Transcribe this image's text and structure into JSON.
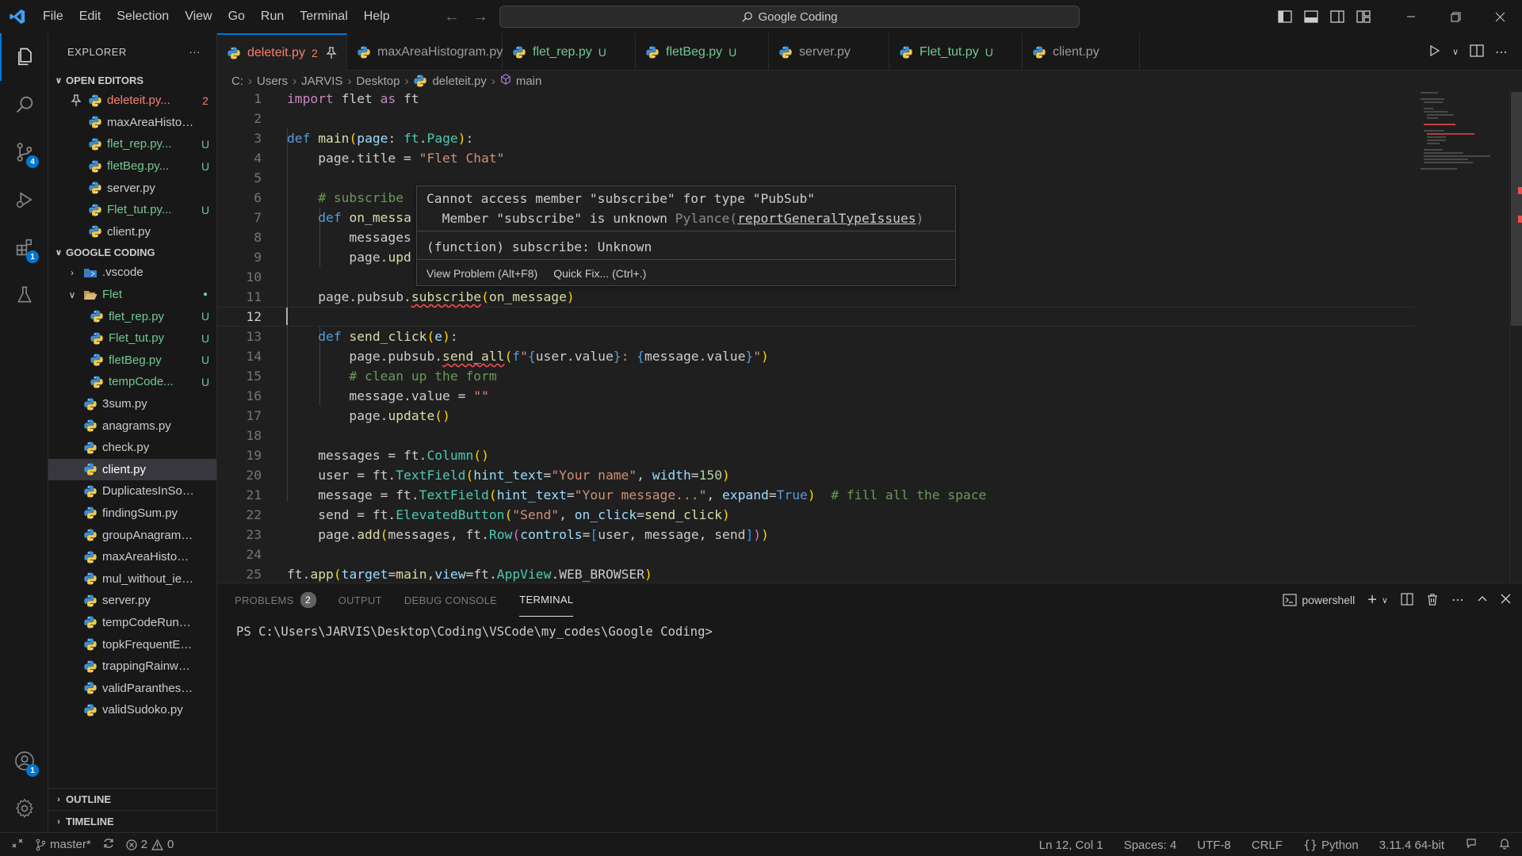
{
  "titlebar": {
    "menu": [
      "File",
      "Edit",
      "Selection",
      "View",
      "Go",
      "Run",
      "Terminal",
      "Help"
    ],
    "search_text": "Google Coding"
  },
  "activity": {
    "source_control_badge": "4",
    "extensions_badge": "1",
    "accounts_badge": "1"
  },
  "sidebar": {
    "title": "EXPLORER",
    "more": "···",
    "open_editors_label": "OPEN EDITORS",
    "open_editors": [
      {
        "name": "deleteit.py...",
        "status": "2",
        "kind": "error",
        "pinned": true
      },
      {
        "name": "maxAreaHistogr...",
        "status": "",
        "kind": "normal"
      },
      {
        "name": "flet_rep.py...",
        "status": "U",
        "kind": "untracked"
      },
      {
        "name": "fletBeg.py...",
        "status": "U",
        "kind": "untracked"
      },
      {
        "name": "server.py",
        "status": "",
        "kind": "normal"
      },
      {
        "name": "Flet_tut.py...",
        "status": "U",
        "kind": "untracked"
      },
      {
        "name": "client.py",
        "status": "",
        "kind": "normal"
      }
    ],
    "folder_label": "GOOGLE CODING",
    "tree": [
      {
        "name": ".vscode",
        "type": "folder-closed",
        "indent": 1,
        "status": "",
        "kind": "normal"
      },
      {
        "name": "Flet",
        "type": "folder-open",
        "indent": 1,
        "status": "●",
        "kind": "untracked"
      },
      {
        "name": "flet_rep.py",
        "type": "file",
        "indent": 2,
        "status": "U",
        "kind": "untracked"
      },
      {
        "name": "Flet_tut.py",
        "type": "file",
        "indent": 2,
        "status": "U",
        "kind": "untracked"
      },
      {
        "name": "fletBeg.py",
        "type": "file",
        "indent": 2,
        "status": "U",
        "kind": "untracked"
      },
      {
        "name": "tempCode...",
        "type": "file",
        "indent": 2,
        "status": "U",
        "kind": "untracked"
      },
      {
        "name": "3sum.py",
        "type": "file",
        "indent": 1,
        "status": "",
        "kind": "normal"
      },
      {
        "name": "anagrams.py",
        "type": "file",
        "indent": 1,
        "status": "",
        "kind": "normal"
      },
      {
        "name": "check.py",
        "type": "file",
        "indent": 1,
        "status": "",
        "kind": "normal"
      },
      {
        "name": "client.py",
        "type": "file",
        "indent": 1,
        "status": "",
        "kind": "selected"
      },
      {
        "name": "DuplicatesInSorte...",
        "type": "file",
        "indent": 1,
        "status": "",
        "kind": "normal"
      },
      {
        "name": "findingSum.py",
        "type": "file",
        "indent": 1,
        "status": "",
        "kind": "normal"
      },
      {
        "name": "groupAnagrams.py",
        "type": "file",
        "indent": 1,
        "status": "",
        "kind": "normal"
      },
      {
        "name": "maxAreaHistogra...",
        "type": "file",
        "indent": 1,
        "status": "",
        "kind": "normal"
      },
      {
        "name": "mul_without_iele...",
        "type": "file",
        "indent": 1,
        "status": "",
        "kind": "normal"
      },
      {
        "name": "server.py",
        "type": "file",
        "indent": 1,
        "status": "",
        "kind": "normal"
      },
      {
        "name": "tempCodeRunner...",
        "type": "file",
        "indent": 1,
        "status": "",
        "kind": "normal"
      },
      {
        "name": "topkFrequentEle...",
        "type": "file",
        "indent": 1,
        "status": "",
        "kind": "normal"
      },
      {
        "name": "trappingRainwate...",
        "type": "file",
        "indent": 1,
        "status": "",
        "kind": "normal"
      },
      {
        "name": "validParanthesis.py",
        "type": "file",
        "indent": 1,
        "status": "",
        "kind": "normal"
      },
      {
        "name": "validSudoko.py",
        "type": "file",
        "indent": 1,
        "status": "",
        "kind": "normal"
      }
    ],
    "outline_label": "OUTLINE",
    "timeline_label": "TIMELINE"
  },
  "tabs": [
    {
      "name": "deleteit.py",
      "badge": "2",
      "active": true,
      "kind": "error"
    },
    {
      "name": "maxAreaHistogram.py",
      "badge": "",
      "active": false,
      "kind": "normal"
    },
    {
      "name": "flet_rep.py",
      "badge": "U",
      "active": false,
      "kind": "untracked"
    },
    {
      "name": "fletBeg.py",
      "badge": "U",
      "active": false,
      "kind": "untracked"
    },
    {
      "name": "server.py",
      "badge": "",
      "active": false,
      "kind": "normal"
    },
    {
      "name": "Flet_tut.py",
      "badge": "U",
      "active": false,
      "kind": "untracked"
    },
    {
      "name": "client.py",
      "badge": "",
      "active": false,
      "kind": "normal"
    }
  ],
  "breadcrumb": [
    "C:",
    "Users",
    "JARVIS",
    "Desktop",
    "deleteit.py",
    "main"
  ],
  "editor": {
    "line_numbers": [
      "1",
      "2",
      "3",
      "4",
      "5",
      "6",
      "7",
      "8",
      "9",
      "10",
      "11",
      "12",
      "13",
      "14",
      "15",
      "16",
      "17",
      "18",
      "19",
      "20",
      "21",
      "22",
      "23",
      "24",
      "25"
    ],
    "current_line": "12"
  },
  "hover": {
    "line1": "Cannot access member \"subscribe\" for type \"PubSub\"",
    "line2_a": "  Member \"subscribe\" is unknown ",
    "line2_source": "Pylance(",
    "line2_rule": "reportGeneralTypeIssues",
    "line2_close": ")",
    "line3": "(function) subscribe: Unknown",
    "action_view": "View Problem (Alt+F8)",
    "action_fix": "Quick Fix... (Ctrl+.)"
  },
  "panel": {
    "tabs": [
      {
        "label": "PROBLEMS",
        "badge": "2",
        "active": false
      },
      {
        "label": "OUTPUT",
        "badge": "",
        "active": false
      },
      {
        "label": "DEBUG CONSOLE",
        "badge": "",
        "active": false
      },
      {
        "label": "TERMINAL",
        "badge": "",
        "active": true
      }
    ],
    "shell": "powershell",
    "terminal_prompt": "PS C:\\Users\\JARVIS\\Desktop\\Coding\\VSCode\\my_codes\\Google Coding>"
  },
  "statusbar": {
    "branch": "master*",
    "errors": "2",
    "warnings": "0",
    "position": "Ln 12, Col 1",
    "spaces": "Spaces: 4",
    "encoding": "UTF-8",
    "eol": "CRLF",
    "language": "Python",
    "interpreter": "3.11.4 64-bit"
  },
  "colors": {
    "accent": "#0078d4",
    "error": "#f88070",
    "untracked": "#73c991"
  }
}
